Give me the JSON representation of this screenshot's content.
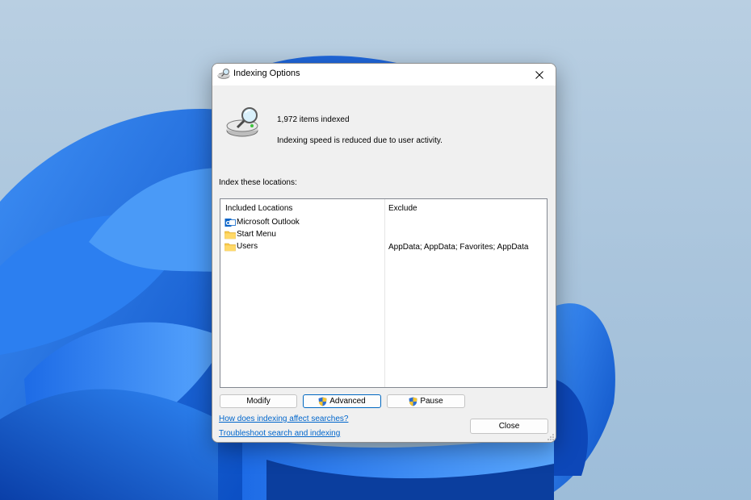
{
  "dialog": {
    "title": "Indexing Options",
    "items_indexed": "1,972 items indexed",
    "status_message": "Indexing speed is reduced due to user activity.",
    "section_label": "Index these locations:"
  },
  "table": {
    "col_included": "Included Locations",
    "col_exclude": "Exclude",
    "rows": [
      {
        "location": "Microsoft Outlook",
        "icon": "outlook-icon",
        "exclude": ""
      },
      {
        "location": "Start Menu",
        "icon": "folder-icon",
        "exclude": ""
      },
      {
        "location": "Users",
        "icon": "folder-icon",
        "exclude": "AppData; AppData; Favorites; AppData"
      }
    ]
  },
  "buttons": {
    "modify": "Modify",
    "advanced": "Advanced",
    "pause": "Pause",
    "close": "Close"
  },
  "links": {
    "how": "How does indexing affect searches?",
    "troubleshoot": "Troubleshoot search and indexing"
  },
  "colors": {
    "link": "#0066cc",
    "accent": "#0067c0",
    "wallpaper_bloom": "#1a6fe0"
  }
}
